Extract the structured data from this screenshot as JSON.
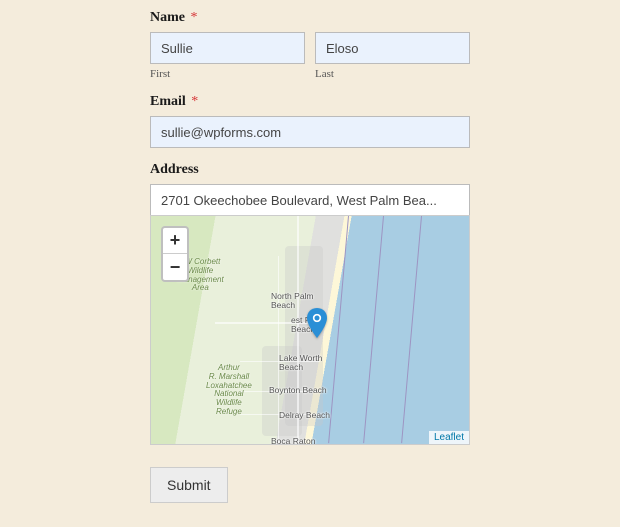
{
  "form": {
    "name": {
      "label": "Name",
      "required_mark": "*",
      "first_value": "Sullie",
      "first_sub": "First",
      "last_value": "Eloso",
      "last_sub": "Last"
    },
    "email": {
      "label": "Email",
      "required_mark": "*",
      "value": "sullie@wpforms.com"
    },
    "address": {
      "label": "Address",
      "value": "2701 Okeechobee Boulevard, West Palm Bea..."
    },
    "submit_label": "Submit"
  },
  "map": {
    "zoom_in": "+",
    "zoom_out": "−",
    "attribution": "Leaflet",
    "labels": {
      "corbett": "JW Corbett\nWildlife\nManagement\nArea",
      "loxahatchee": "Arthur\nR. Marshall\nLoxahatchee\nNational\nWildlife\nRefuge",
      "north_palm": "North Palm\nBeach",
      "west_palm": "est Palm\nBeach",
      "lake_worth": "Lake Worth\nBeach",
      "boynton": "Boynton Beach",
      "delray": "Delray Beach",
      "boca": "Boca Raton"
    }
  }
}
